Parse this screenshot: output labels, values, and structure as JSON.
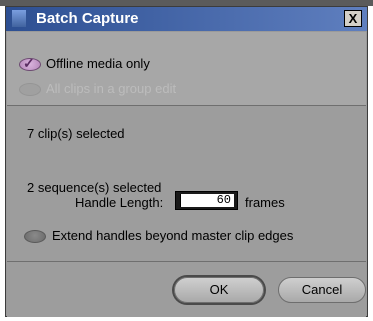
{
  "dialog": {
    "title": "Batch Capture",
    "close_glyph": "X"
  },
  "options": {
    "offline_media_only": "Offline media only",
    "all_clips_group_edit": "All clips in a group edit"
  },
  "info": {
    "clips_selected": "7 clip(s) selected",
    "sequences_selected": "2 sequence(s) selected"
  },
  "handle": {
    "label": "Handle Length:",
    "value": "60",
    "unit": "frames"
  },
  "extend_handles": "Extend handles beyond master clip edges",
  "buttons": {
    "ok": "OK",
    "cancel": "Cancel"
  }
}
